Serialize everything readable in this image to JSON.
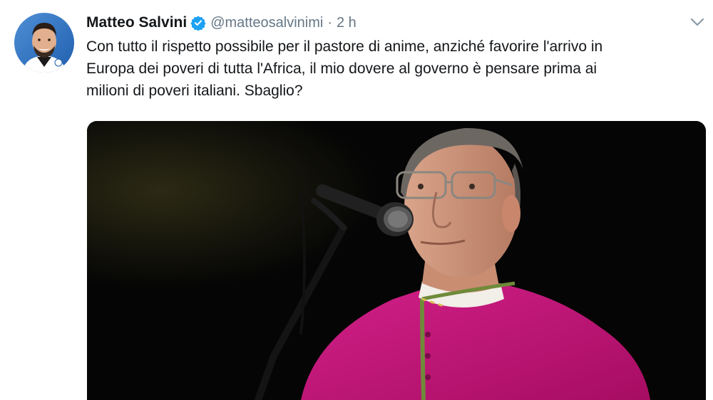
{
  "tweet": {
    "author": {
      "name": "Matteo Salvini",
      "handle": "@matteosalvinimi",
      "verified": true,
      "avatar_icon": "profile-photo"
    },
    "separator": "·",
    "time": "2 h",
    "text_lines": [
      "Con tutto il rispetto possibile per il pastore di anime, anziché favorire l'arrivo in",
      "Europa dei poveri di tutta l'Africa, il mio dovere al governo è pensare prima ai",
      "milioni di poveri italiani. Sbaglio?"
    ],
    "menu_icon": "chevron-down-icon",
    "colors": {
      "text": "#14171a",
      "secondary": "#657786",
      "verified_badge": "#1da1f2",
      "robe": "#c8187a"
    }
  }
}
